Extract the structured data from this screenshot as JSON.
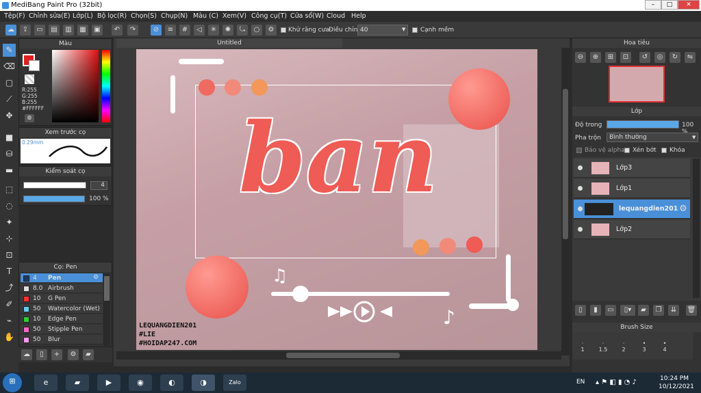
{
  "window": {
    "title": "MediBang Paint Pro (32bit)"
  },
  "menu": [
    "Tệp(F)",
    "Chỉnh sửa(E)",
    "Lớp(L)",
    "Bộ lọc(R)",
    "Chọn(S)",
    "Chụp(N)",
    "Màu (C)",
    "Xem(V)",
    "Công cụ(T)",
    "Cửa sổ(W)",
    "Cloud",
    "Help"
  ],
  "toolbar": {
    "antialias_label": "Khử răng cưa",
    "adjust_label": "Điều chỉnh",
    "adjust_value": "40",
    "edge_label": "Cạnh mềm"
  },
  "color_panel": {
    "title": "Màu",
    "r": "R:255",
    "g": "G:255",
    "b": "B:255",
    "hex": "#FFFFFF"
  },
  "brush_preview": {
    "title": "Xem trước cọ",
    "size": "0.29mm"
  },
  "brush_control": {
    "title": "Kiểm soát cọ",
    "size_value": "4",
    "opacity_value": "100 %",
    "opacity_fraction": 1.0
  },
  "brush_list": {
    "title": "Cọ: Pen",
    "items": [
      {
        "size": "4",
        "name": "Pen",
        "color": "#1e3a5f"
      },
      {
        "size": "8.0",
        "name": "Airbrush",
        "color": "#dddddd"
      },
      {
        "size": "10",
        "name": "G Pen",
        "color": "#ff3030"
      },
      {
        "size": "50",
        "name": "Watercolor (Wet)",
        "color": "#66ccee"
      },
      {
        "size": "10",
        "name": "Edge Pen",
        "color": "#33cc33"
      },
      {
        "size": "50",
        "name": "Stipple Pen",
        "color": "#ff66cc"
      },
      {
        "size": "50",
        "name": "Blur",
        "color": "#ff99ee"
      }
    ]
  },
  "canvas": {
    "tab_title": "Untitled",
    "artwork_word": "ban",
    "watermark_lines": [
      "LEQUANGDIEN201",
      "#LIE",
      "#HOIDAP247.COM"
    ]
  },
  "navigator": {
    "title": "Hoa tiêu"
  },
  "layers": {
    "title": "Lớp",
    "opacity_label": "Độ trong",
    "opacity_value": "100 %",
    "opacity_fraction": 1.0,
    "blend_label": "Pha trộn",
    "blend_value": "Bình thường",
    "protect_alpha": "Bảo vệ alpha",
    "clip": "Xén bớt",
    "lock": "Khóa",
    "items": [
      {
        "name": "Lớp3"
      },
      {
        "name": "Lớp1"
      },
      {
        "name": "lequangdien201"
      },
      {
        "name": "Lớp2"
      }
    ]
  },
  "brush_size": {
    "title": "Brush Size",
    "sizes": [
      "1",
      "1.5",
      "2",
      "3",
      "4"
    ]
  },
  "taskbar": {
    "lang": "EN",
    "time": "10:24 PM",
    "date": "10/12/2021",
    "zalo": "Zalo"
  },
  "colors": {
    "accent": "#4a90d9",
    "canvas_pink": "#c9a4aa",
    "letter": "#ef5b55"
  }
}
